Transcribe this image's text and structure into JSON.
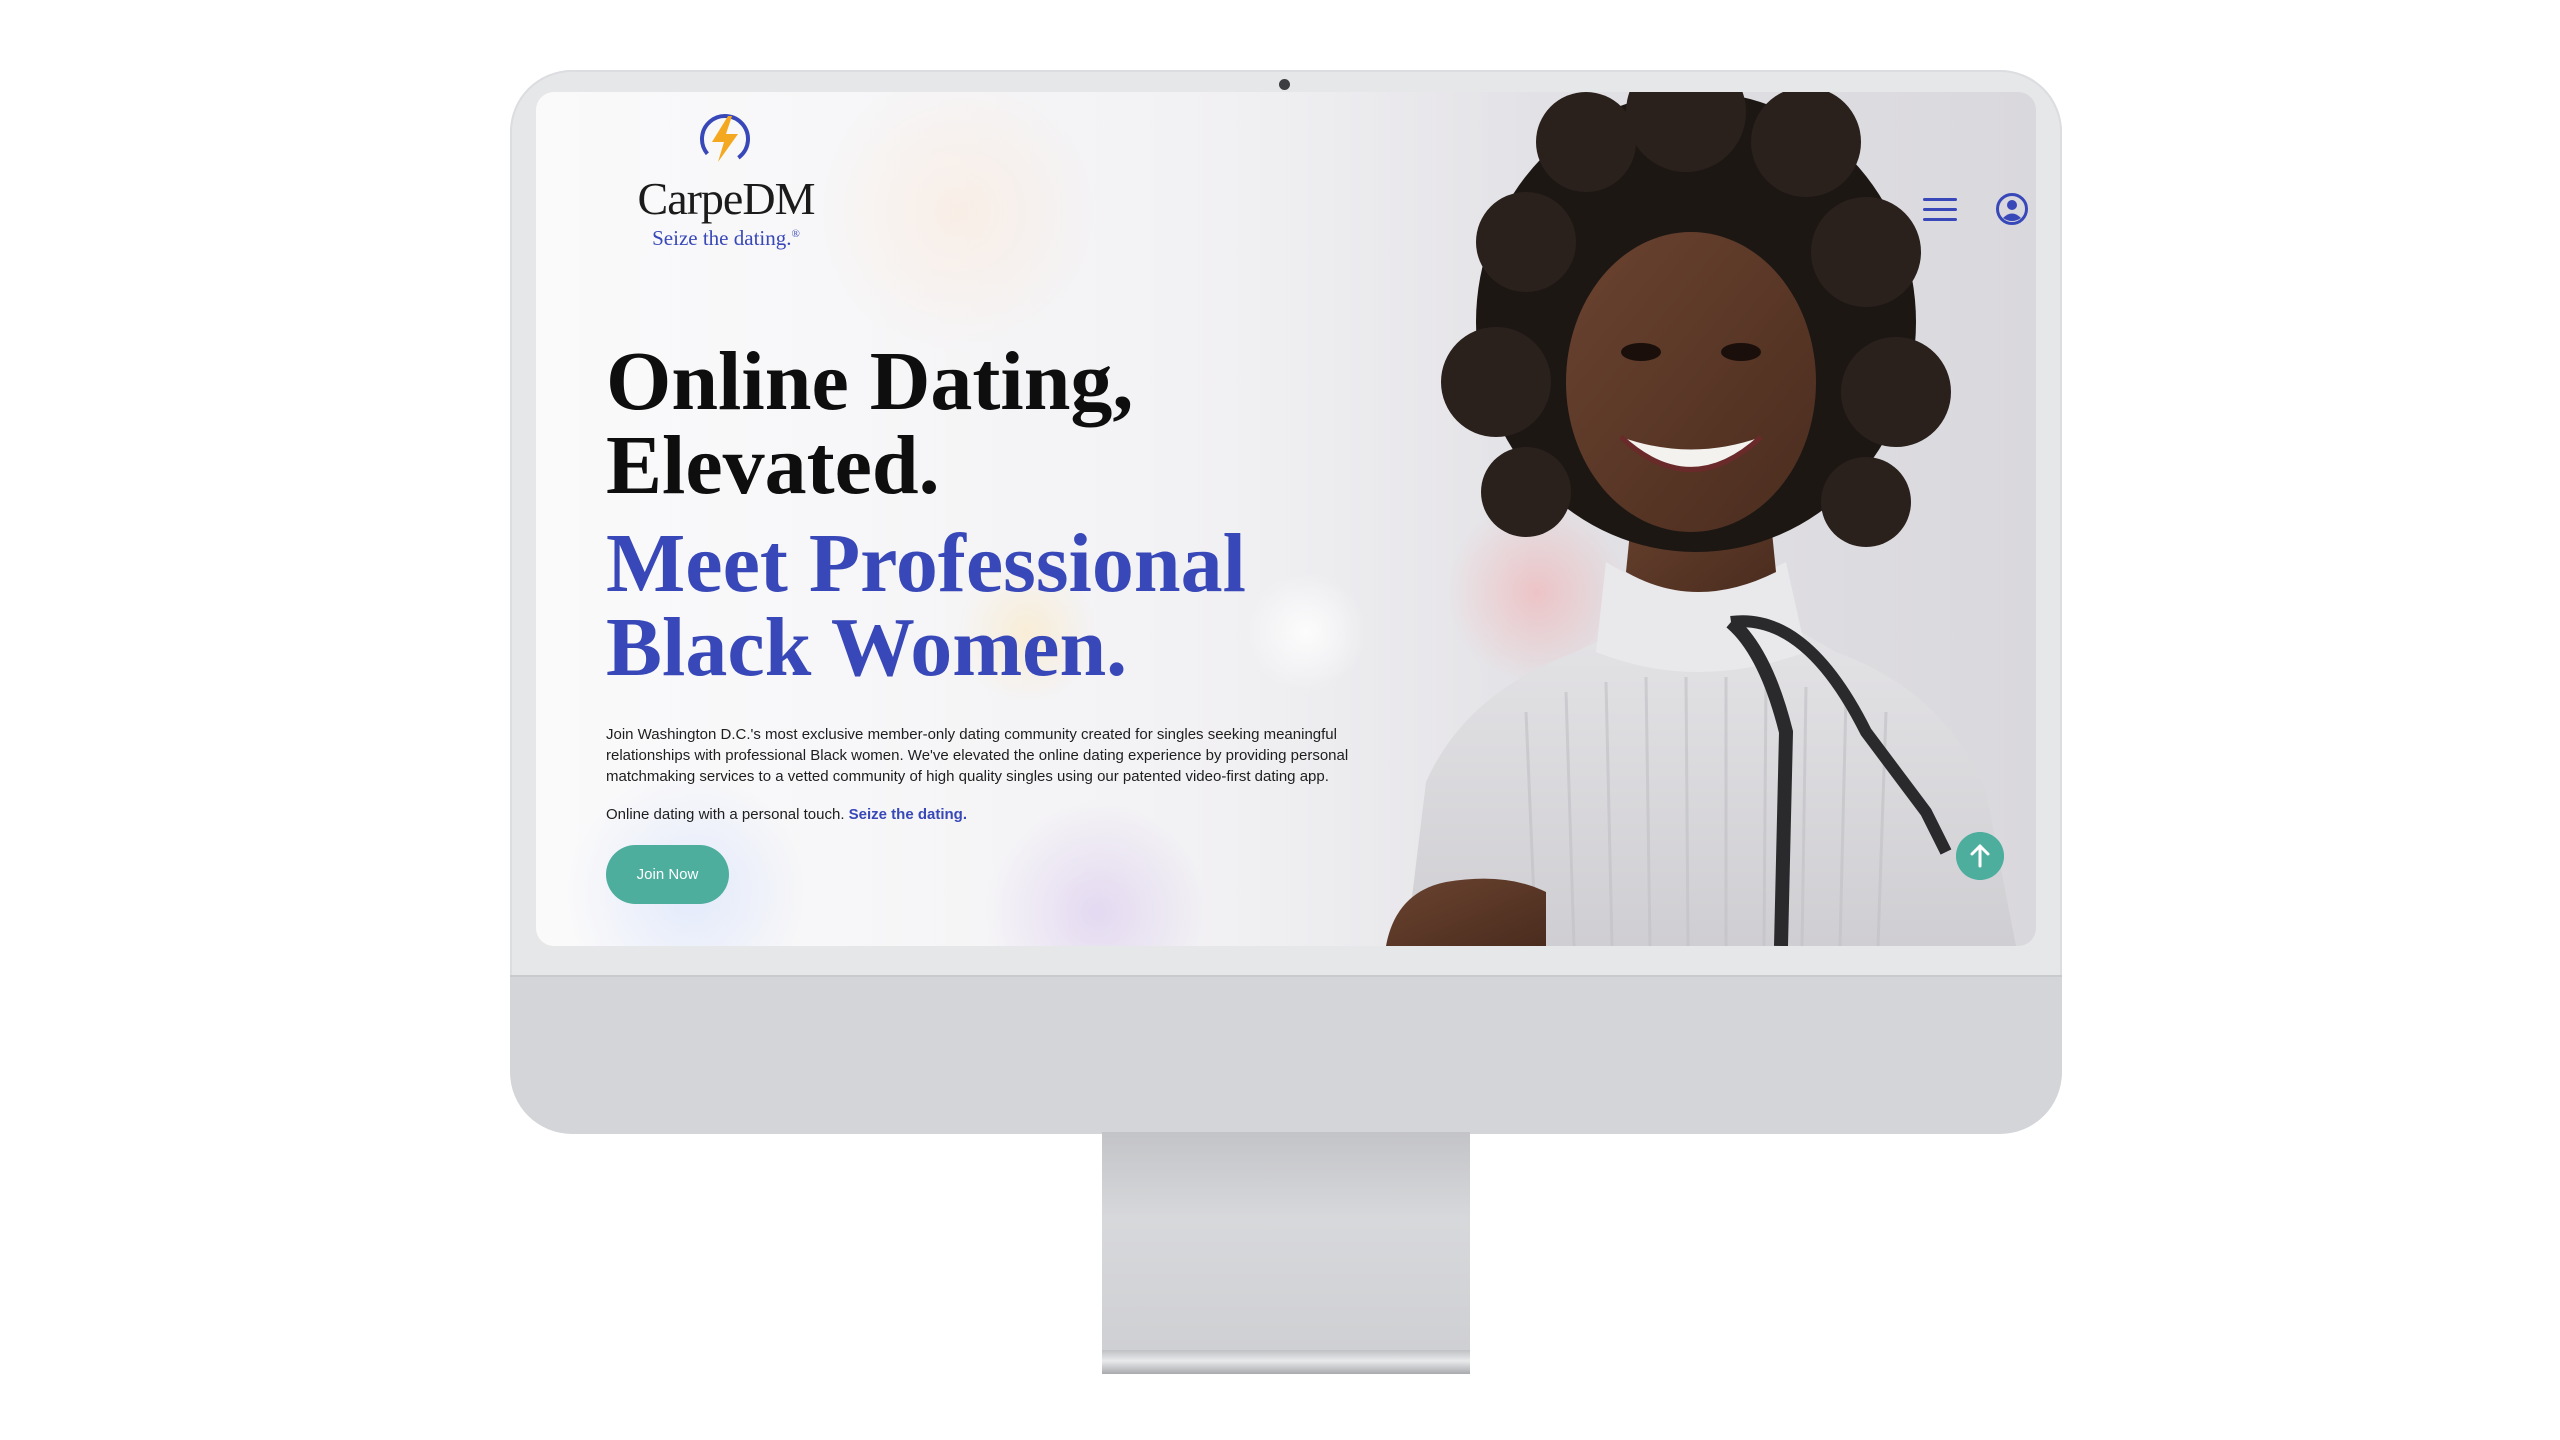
{
  "brand": {
    "name": "CarpeDM",
    "tagline": "Seize the dating.",
    "trademark": "®",
    "colors": {
      "primary_blue": "#3848b8",
      "accent_teal": "#4dae9e",
      "logo_orange": "#f4a81f"
    }
  },
  "nav": {
    "menu_icon": "hamburger-menu-icon",
    "account_icon": "user-circle-icon"
  },
  "hero": {
    "headline_line1": "Online Dating,",
    "headline_line2": "Elevated.",
    "subheadline_line1": "Meet Professional",
    "subheadline_line2": "Black Women.",
    "body": "Join Washington D.C.'s most exclusive member-only dating community created for singles seeking meaningful relationships with professional Black women. We've elevated the online dating experience by providing personal matchmaking services to a vetted community of high quality singles using our patented video-first dating app.",
    "tagline_prefix": "Online dating with a personal touch.",
    "tagline_accent": "Seize the dating.",
    "cta_label": "Join Now"
  },
  "scroll_top_icon": "arrow-up-icon"
}
